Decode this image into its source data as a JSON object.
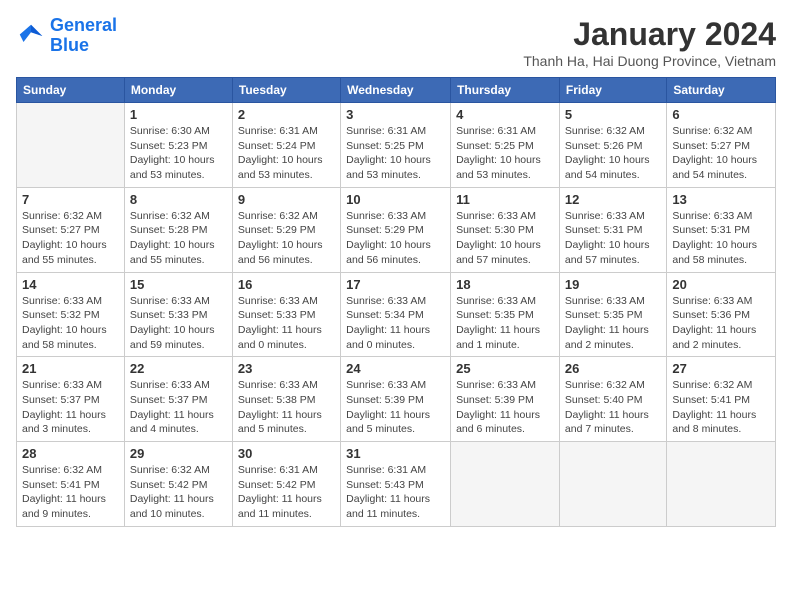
{
  "logo": {
    "line1": "General",
    "line2": "Blue"
  },
  "title": "January 2024",
  "subtitle": "Thanh Ha, Hai Duong Province, Vietnam",
  "weekdays": [
    "Sunday",
    "Monday",
    "Tuesday",
    "Wednesday",
    "Thursday",
    "Friday",
    "Saturday"
  ],
  "weeks": [
    [
      {
        "day": "",
        "info": ""
      },
      {
        "day": "1",
        "info": "Sunrise: 6:30 AM\nSunset: 5:23 PM\nDaylight: 10 hours\nand 53 minutes."
      },
      {
        "day": "2",
        "info": "Sunrise: 6:31 AM\nSunset: 5:24 PM\nDaylight: 10 hours\nand 53 minutes."
      },
      {
        "day": "3",
        "info": "Sunrise: 6:31 AM\nSunset: 5:25 PM\nDaylight: 10 hours\nand 53 minutes."
      },
      {
        "day": "4",
        "info": "Sunrise: 6:31 AM\nSunset: 5:25 PM\nDaylight: 10 hours\nand 53 minutes."
      },
      {
        "day": "5",
        "info": "Sunrise: 6:32 AM\nSunset: 5:26 PM\nDaylight: 10 hours\nand 54 minutes."
      },
      {
        "day": "6",
        "info": "Sunrise: 6:32 AM\nSunset: 5:27 PM\nDaylight: 10 hours\nand 54 minutes."
      }
    ],
    [
      {
        "day": "7",
        "info": "Sunrise: 6:32 AM\nSunset: 5:27 PM\nDaylight: 10 hours\nand 55 minutes."
      },
      {
        "day": "8",
        "info": "Sunrise: 6:32 AM\nSunset: 5:28 PM\nDaylight: 10 hours\nand 55 minutes."
      },
      {
        "day": "9",
        "info": "Sunrise: 6:32 AM\nSunset: 5:29 PM\nDaylight: 10 hours\nand 56 minutes."
      },
      {
        "day": "10",
        "info": "Sunrise: 6:33 AM\nSunset: 5:29 PM\nDaylight: 10 hours\nand 56 minutes."
      },
      {
        "day": "11",
        "info": "Sunrise: 6:33 AM\nSunset: 5:30 PM\nDaylight: 10 hours\nand 57 minutes."
      },
      {
        "day": "12",
        "info": "Sunrise: 6:33 AM\nSunset: 5:31 PM\nDaylight: 10 hours\nand 57 minutes."
      },
      {
        "day": "13",
        "info": "Sunrise: 6:33 AM\nSunset: 5:31 PM\nDaylight: 10 hours\nand 58 minutes."
      }
    ],
    [
      {
        "day": "14",
        "info": "Sunrise: 6:33 AM\nSunset: 5:32 PM\nDaylight: 10 hours\nand 58 minutes."
      },
      {
        "day": "15",
        "info": "Sunrise: 6:33 AM\nSunset: 5:33 PM\nDaylight: 10 hours\nand 59 minutes."
      },
      {
        "day": "16",
        "info": "Sunrise: 6:33 AM\nSunset: 5:33 PM\nDaylight: 11 hours\nand 0 minutes."
      },
      {
        "day": "17",
        "info": "Sunrise: 6:33 AM\nSunset: 5:34 PM\nDaylight: 11 hours\nand 0 minutes."
      },
      {
        "day": "18",
        "info": "Sunrise: 6:33 AM\nSunset: 5:35 PM\nDaylight: 11 hours\nand 1 minute."
      },
      {
        "day": "19",
        "info": "Sunrise: 6:33 AM\nSunset: 5:35 PM\nDaylight: 11 hours\nand 2 minutes."
      },
      {
        "day": "20",
        "info": "Sunrise: 6:33 AM\nSunset: 5:36 PM\nDaylight: 11 hours\nand 2 minutes."
      }
    ],
    [
      {
        "day": "21",
        "info": "Sunrise: 6:33 AM\nSunset: 5:37 PM\nDaylight: 11 hours\nand 3 minutes."
      },
      {
        "day": "22",
        "info": "Sunrise: 6:33 AM\nSunset: 5:37 PM\nDaylight: 11 hours\nand 4 minutes."
      },
      {
        "day": "23",
        "info": "Sunrise: 6:33 AM\nSunset: 5:38 PM\nDaylight: 11 hours\nand 5 minutes."
      },
      {
        "day": "24",
        "info": "Sunrise: 6:33 AM\nSunset: 5:39 PM\nDaylight: 11 hours\nand 5 minutes."
      },
      {
        "day": "25",
        "info": "Sunrise: 6:33 AM\nSunset: 5:39 PM\nDaylight: 11 hours\nand 6 minutes."
      },
      {
        "day": "26",
        "info": "Sunrise: 6:32 AM\nSunset: 5:40 PM\nDaylight: 11 hours\nand 7 minutes."
      },
      {
        "day": "27",
        "info": "Sunrise: 6:32 AM\nSunset: 5:41 PM\nDaylight: 11 hours\nand 8 minutes."
      }
    ],
    [
      {
        "day": "28",
        "info": "Sunrise: 6:32 AM\nSunset: 5:41 PM\nDaylight: 11 hours\nand 9 minutes."
      },
      {
        "day": "29",
        "info": "Sunrise: 6:32 AM\nSunset: 5:42 PM\nDaylight: 11 hours\nand 10 minutes."
      },
      {
        "day": "30",
        "info": "Sunrise: 6:31 AM\nSunset: 5:42 PM\nDaylight: 11 hours\nand 11 minutes."
      },
      {
        "day": "31",
        "info": "Sunrise: 6:31 AM\nSunset: 5:43 PM\nDaylight: 11 hours\nand 11 minutes."
      },
      {
        "day": "",
        "info": ""
      },
      {
        "day": "",
        "info": ""
      },
      {
        "day": "",
        "info": ""
      }
    ]
  ]
}
